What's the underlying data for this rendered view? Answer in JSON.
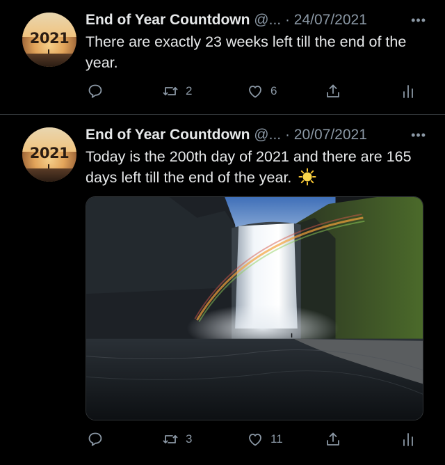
{
  "tweets": [
    {
      "avatar_text": "2021",
      "name": "End of Year Countdown",
      "handle": "@...",
      "date": "· 24/07/2021",
      "more": "•••",
      "text": "There are exactly 23 weeks left till the end of the year.",
      "emoji": "",
      "retweets": "2",
      "likes": "6",
      "has_media": false
    },
    {
      "avatar_text": "2021",
      "name": "End of Year Countdown",
      "handle": "@...",
      "date": "· 20/07/2021",
      "more": "•••",
      "text": "Today is the 200th day of 2021 and there are 165 days left till the end of the year.",
      "emoji": "sun",
      "retweets": "3",
      "likes": "11",
      "has_media": true,
      "media_description": "waterfall with rainbow photo"
    }
  ],
  "colors": {
    "background": "#000000",
    "text": "#e7e9ea",
    "secondary": "#8b98a5",
    "divider": "#2f3336"
  },
  "icons": {
    "reply": "reply-icon",
    "retweet": "retweet-icon",
    "like": "heart-icon",
    "share": "share-icon",
    "stats": "analytics-icon",
    "more": "more-icon"
  }
}
